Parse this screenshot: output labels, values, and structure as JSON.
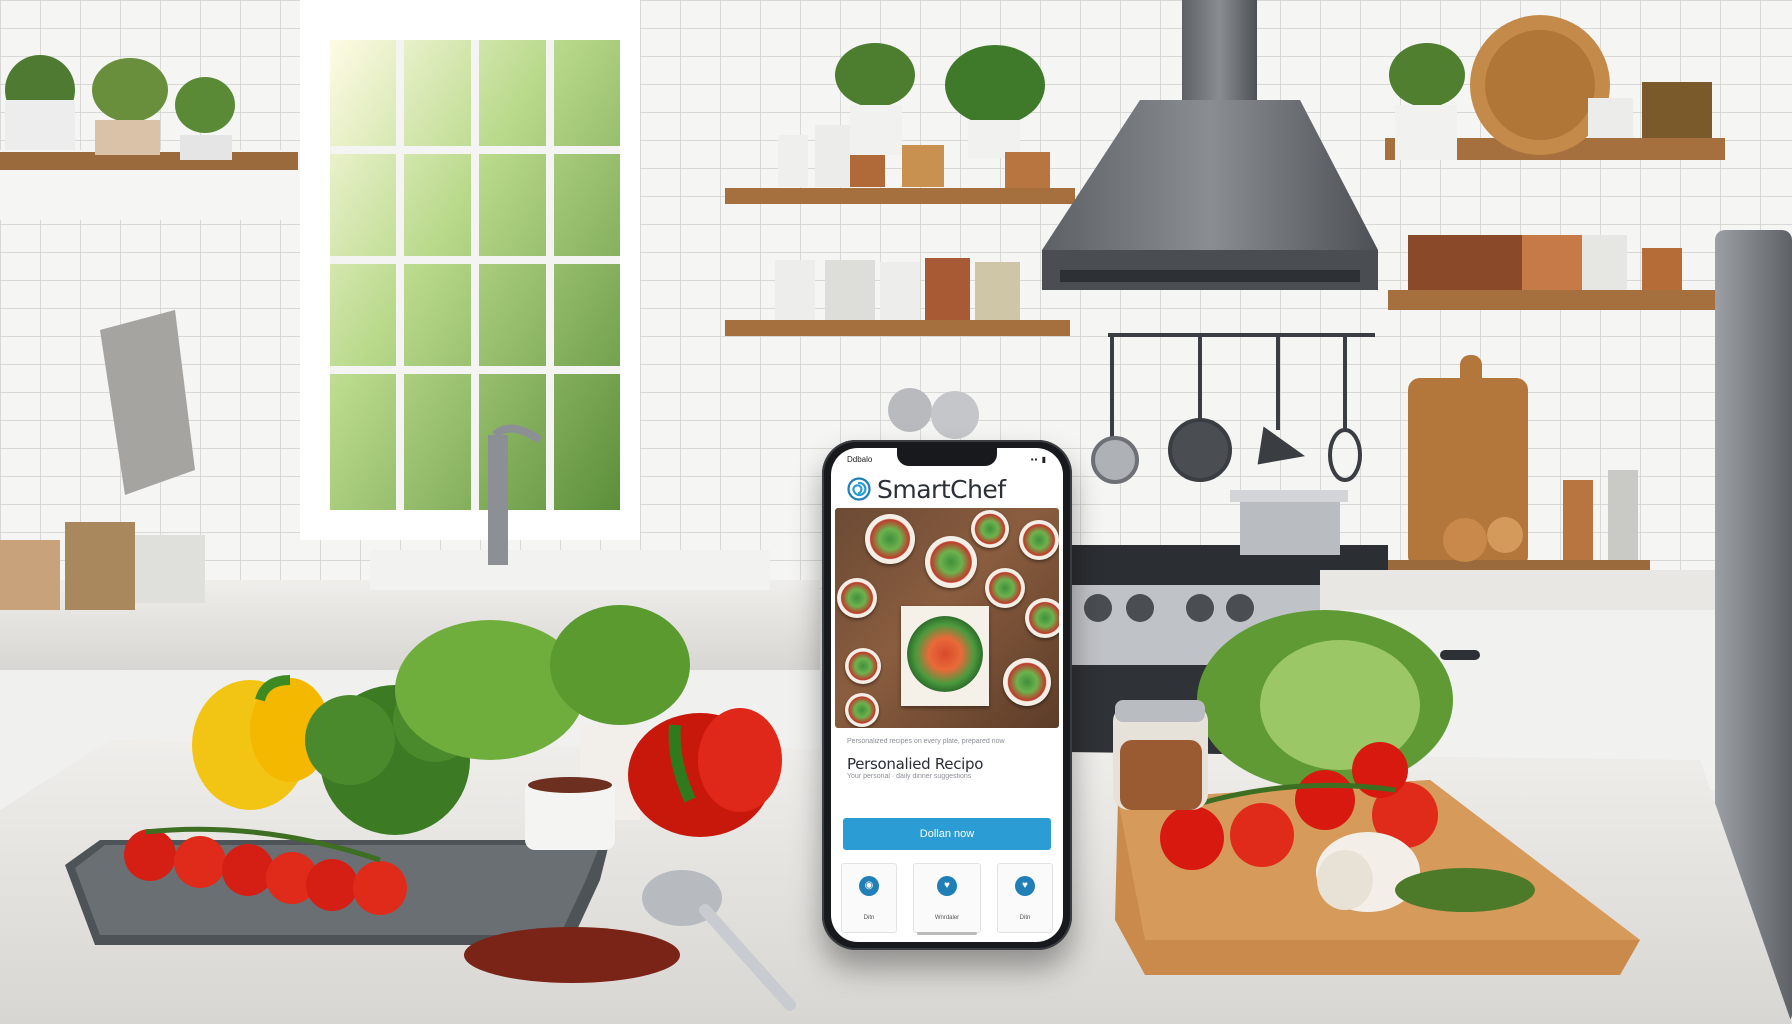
{
  "colors": {
    "brand": "#2c9cd4",
    "brand_dark": "#1f7fb6",
    "tile": "#f5f5f3",
    "wood": "#b87a45",
    "counter": "#e8e7e4"
  },
  "phone": {
    "status_left": "Ddbalo",
    "status_right": "▪▪ ▮",
    "app_title": "SmartChef",
    "logo_icon": "spiral-logo-icon",
    "fine_print_1": "Personalized recipes on every plate, prepared now",
    "recipe_heading": "Personalied Recipo",
    "fine_print_2": "Your personal · daily dinner suggestions",
    "cta_label": "Dollan now",
    "nav": [
      {
        "icon": "chef-icon",
        "label": "Ditn"
      },
      {
        "icon": "heart-icon",
        "label": "Wnrdaler"
      },
      {
        "icon": "heart-icon",
        "label": "Ditn"
      }
    ]
  }
}
